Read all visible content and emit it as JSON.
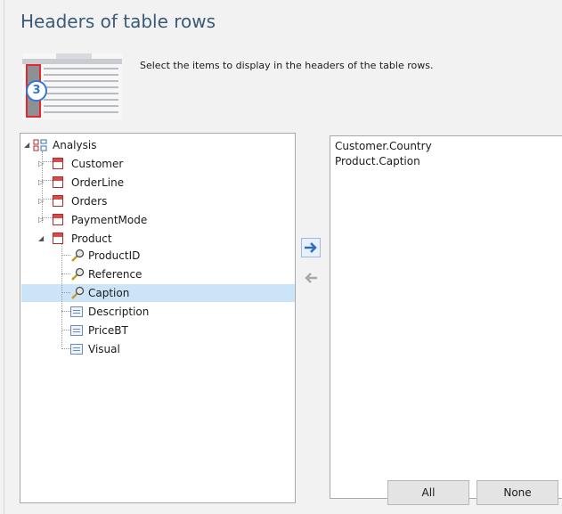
{
  "title": "Headers of table rows",
  "step_badge": "3",
  "instruction": "Select the items to display in the headers of the table rows.",
  "tree": {
    "root": "Analysis",
    "tables": [
      "Customer",
      "OrderLine",
      "Orders",
      "PaymentMode",
      "Product"
    ],
    "product_fields": [
      "ProductID",
      "Reference",
      "Caption",
      "Description",
      "PriceBT",
      "Visual"
    ],
    "selected": "Caption"
  },
  "selected_items": [
    "Customer.Country",
    "Product.Caption"
  ],
  "buttons": {
    "all": "All",
    "none": "None"
  },
  "colors": {
    "title": "#3b5a78",
    "selection": "#cce4f7",
    "arrow_active": "#2f6fb8",
    "arrow_disabled": "#a8a8a8"
  }
}
